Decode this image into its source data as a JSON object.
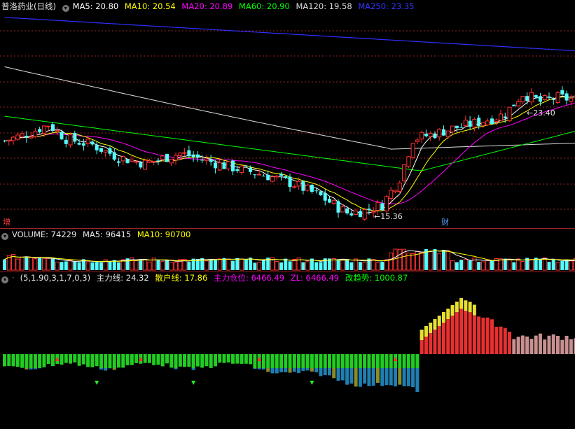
{
  "price_header": {
    "stock": "普洛药业",
    "period": "(日线)",
    "ma5": "MA5: 20.80",
    "ma10": "MA10: 20.54",
    "ma20": "MA20: 20.89",
    "ma60": "MA60: 20.90",
    "ma120": "MA120: 19.58",
    "ma250": "MA250: 23.35"
  },
  "price_labels": {
    "high": "23.40",
    "low": "15.36",
    "zeng_badge": "增",
    "cai_badge": "财"
  },
  "volume_header": {
    "volume": "VOLUME: 74229",
    "ma5": "MA5: 96415",
    "ma10": "MA10: 90700"
  },
  "indicator_header": {
    "params": "(5,1.90,3,1,7,0,3)",
    "main_force": "主力线: 24.32",
    "retail": "散户线: 17.86",
    "position": "主力仓位: 6466.49",
    "zl": "ZL: 6466.49",
    "trend": "改趋势: 1000.87"
  },
  "colors": {
    "up": "#ff3232",
    "down": "#54ffff",
    "ma5": "#ffffff",
    "ma10": "#ffff00",
    "ma20": "#ff00ff",
    "ma60": "#00ff00",
    "ma120": "#dcdcdc",
    "ma250": "#3030ff",
    "grid": "#9b2424"
  },
  "chart_data": {
    "type": "candlestick",
    "price_range": [
      14.9,
      25.3
    ],
    "ma_current": {
      "MA5": 20.8,
      "MA10": 20.54,
      "MA20": 20.89,
      "MA60": 20.9,
      "MA120": 19.58,
      "MA250": 23.35
    },
    "marked_high": 23.4,
    "marked_low": 15.36,
    "latest_volume": 74229,
    "volume_ma5": 96415,
    "volume_ma10": 90700
  }
}
